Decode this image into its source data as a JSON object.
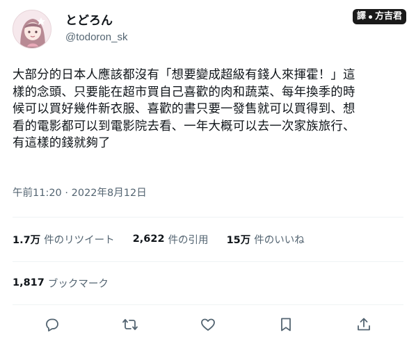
{
  "author": {
    "display_name": "とどろん",
    "handle": "@todoron_sk"
  },
  "credit": {
    "prefix": "譯",
    "name": "方吉君"
  },
  "tweet": {
    "lines": [
      "大部分的日本人應該都沒有「想要變成超級有錢人來揮霍！」這",
      "樣的念頭、只要能在超市買自己喜歡的肉和蔬菜、每年換季的時",
      "候可以買好幾件新衣服、喜歡的書只要一發售就可以買得到、想",
      "看的電影都可以到電影院去看、一年大概可以去一次家族旅行、",
      "有這樣的錢就夠了"
    ],
    "timestamp": "午前11:20 · 2022年8月12日"
  },
  "stats": {
    "retweets_num": "1.7万",
    "retweets_label": "件のリツイート",
    "quotes_num": "2,622",
    "quotes_label": "件の引用",
    "likes_num": "15万",
    "likes_label": "件のいいね",
    "bookmarks_num": "1,817",
    "bookmarks_label": "ブックマーク"
  },
  "actions": [
    "reply-icon",
    "retweet-icon",
    "like-icon",
    "bookmark-icon",
    "share-icon"
  ],
  "colors": {
    "text": "#0f1419",
    "secondary": "#536471",
    "divider": "#eff3f4"
  }
}
